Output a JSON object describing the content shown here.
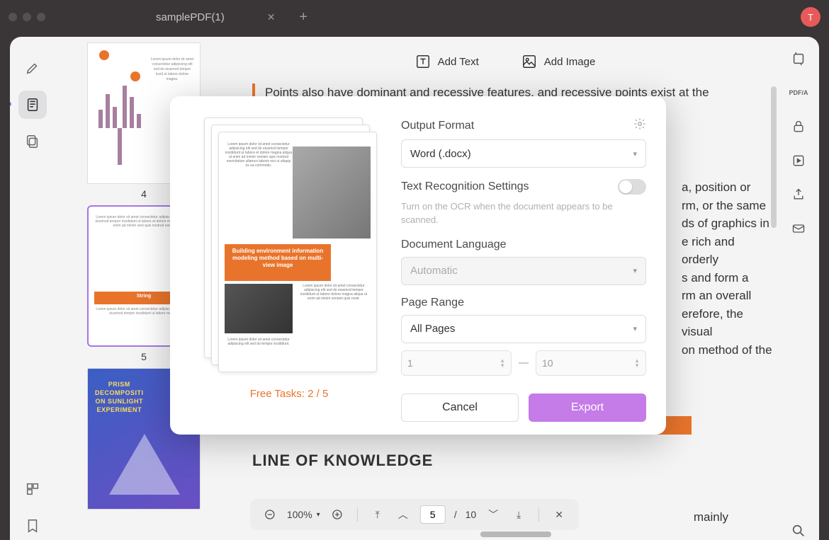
{
  "titlebar": {
    "tab_name": "samplePDF(1)",
    "avatar_letter": "T"
  },
  "left_tools": {
    "highlight": "highlight",
    "annotate": "annotate",
    "copy": "copy",
    "outline": "outline",
    "bookmark": "bookmark"
  },
  "thumbs": {
    "page4": "4",
    "page5": "5",
    "page5_stripe": "String",
    "page6_title": "PRISM\nDECOMPOSITI\nON SUNLIGHT\nEXPERIMENT"
  },
  "top_actions": {
    "add_text": "Add Text",
    "add_image": "Add Image"
  },
  "doc": {
    "para1": "Points also have dominant and recessive features, and recessive points exist at the",
    "para2_tail": "a, position or\nrm, or the same\nds of graphics in\ne rich and orderly\ns and form a\nrm an overall\nerefore, the visual\non method of the",
    "h2": "LINE OF KNOWLEDGE",
    "mainly": "mainly"
  },
  "modal": {
    "output_format_label": "Output Format",
    "output_format_value": "Word (.docx)",
    "ocr_label": "Text Recognition Settings",
    "ocr_hint": "Turn on the OCR when the document appears to be scanned.",
    "lang_label": "Document Language",
    "lang_value": "Automatic",
    "range_label": "Page Range",
    "range_value": "All Pages",
    "range_from": "1",
    "range_to": "10",
    "cancel": "Cancel",
    "export": "Export",
    "free_tasks": "Free Tasks: 2 / 5",
    "preview_band": "Building environment information modeling method based on multi-view image"
  },
  "page_controls": {
    "zoom": "100%",
    "current": "5",
    "sep": "/",
    "total": "10"
  }
}
